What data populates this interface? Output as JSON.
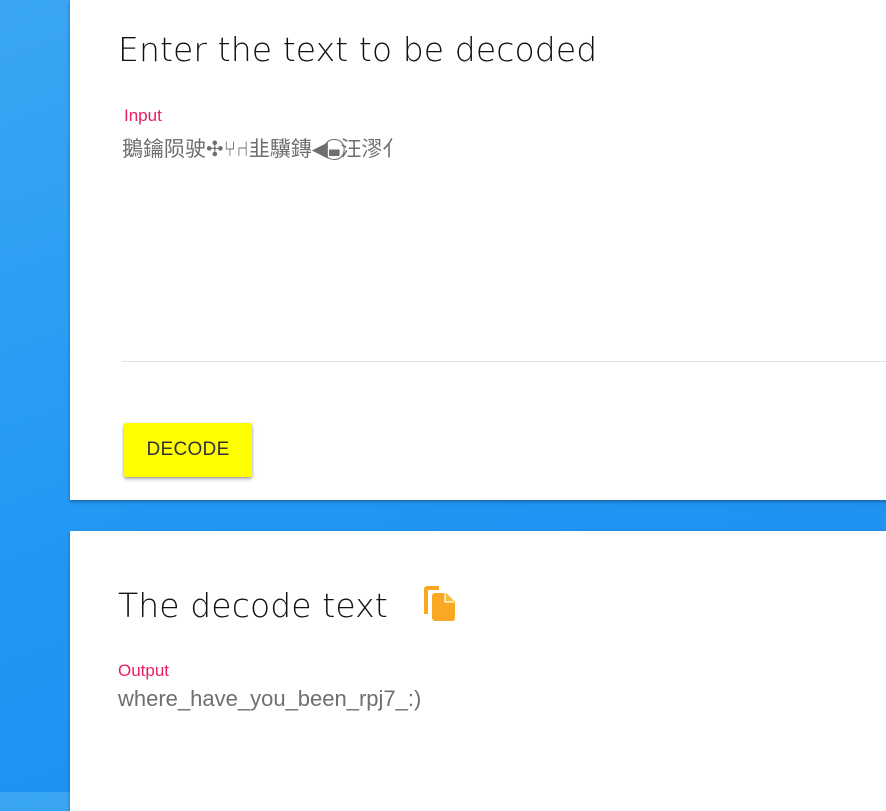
{
  "input_card": {
    "title": "Enter the text to be decoded",
    "input_label": "Input",
    "input_value": "鵝​鑰陨驶✣⑂⑁韭驥鏄◀▬⃝汪漻⺅",
    "decode_button_label": "DECODE",
    "accent_color": "#e91e63",
    "button_color": "#ffff00"
  },
  "output_card": {
    "title": "The decode text",
    "copy_icon": "copy-file-icon",
    "copy_icon_color": "#f9a825",
    "output_label": "Output",
    "output_value": "where_have_you_been_rpj7_:)"
  }
}
